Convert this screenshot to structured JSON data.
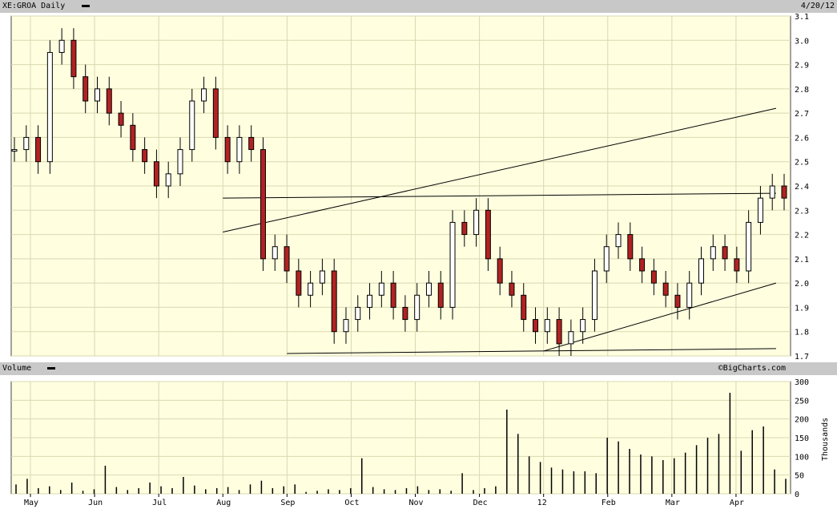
{
  "chart_data": [
    {
      "type": "candlestick",
      "title": "XE:GROA Daily",
      "date_stamp": "4/20/12",
      "ylim": [
        1.7,
        3.1
      ],
      "y_ticks": [
        "1.7",
        "1.8",
        "1.9",
        "2.0",
        "2.1",
        "2.2",
        "2.3",
        "2.4",
        "2.5",
        "2.6",
        "2.7",
        "2.8",
        "2.9",
        "3.0",
        "3.1"
      ],
      "x_labels": [
        "May",
        "Jun",
        "Jul",
        "Aug",
        "Sep",
        "Oct",
        "Nov",
        "Dec",
        "12",
        "Feb",
        "Mar",
        "Apr"
      ],
      "closes": [
        2.55,
        2.6,
        2.5,
        2.95,
        3.0,
        2.85,
        2.75,
        2.8,
        2.7,
        2.65,
        2.55,
        2.5,
        2.4,
        2.45,
        2.55,
        2.75,
        2.8,
        2.6,
        2.5,
        2.6,
        2.55,
        2.1,
        2.15,
        2.05,
        1.95,
        2.0,
        2.05,
        1.8,
        1.85,
        1.9,
        1.95,
        2.0,
        1.9,
        1.85,
        1.95,
        2.0,
        1.9,
        2.25,
        2.2,
        2.3,
        2.1,
        2.0,
        1.95,
        1.85,
        1.8,
        1.85,
        1.75,
        1.8,
        1.85,
        2.05,
        2.15,
        2.2,
        2.1,
        2.05,
        2.0,
        1.95,
        1.9,
        2.0,
        2.1,
        2.15,
        2.1,
        2.05,
        2.25,
        2.35,
        2.4,
        2.35
      ],
      "trendlines": [
        {
          "from": [
            "Aug",
            2.35
          ],
          "to": [
            "Apr",
            2.37
          ]
        },
        {
          "from": [
            "Sep",
            1.71
          ],
          "to": [
            "Apr",
            1.73
          ]
        },
        {
          "from": [
            "Aug",
            2.21
          ],
          "to": [
            "Apr",
            2.72
          ]
        },
        {
          "from": [
            "12",
            1.72
          ],
          "to": [
            "Apr",
            2.0
          ]
        }
      ]
    },
    {
      "type": "bar",
      "title": "Volume",
      "ylabel": "Thousands",
      "ylim": [
        0,
        300
      ],
      "y_ticks": [
        "0",
        "50",
        "100",
        "150",
        "200",
        "250",
        "300"
      ],
      "values": [
        25,
        40,
        15,
        20,
        10,
        30,
        8,
        12,
        75,
        18,
        10,
        15,
        30,
        20,
        15,
        45,
        22,
        12,
        15,
        18,
        10,
        25,
        35,
        15,
        20,
        25,
        5,
        8,
        12,
        10,
        15,
        95,
        18,
        12,
        10,
        15,
        20,
        10,
        12,
        8,
        55,
        10,
        15,
        20,
        225,
        160,
        100,
        85,
        70,
        65,
        60,
        60,
        55,
        150,
        140,
        120,
        105,
        100,
        90,
        95,
        110,
        130,
        150,
        160,
        270,
        115,
        170,
        180,
        65,
        40
      ]
    }
  ],
  "header": {
    "price_title": "XE:GROA Daily",
    "date": "4/20/12",
    "volume_title": "Volume",
    "credit": "©BigCharts.com"
  }
}
